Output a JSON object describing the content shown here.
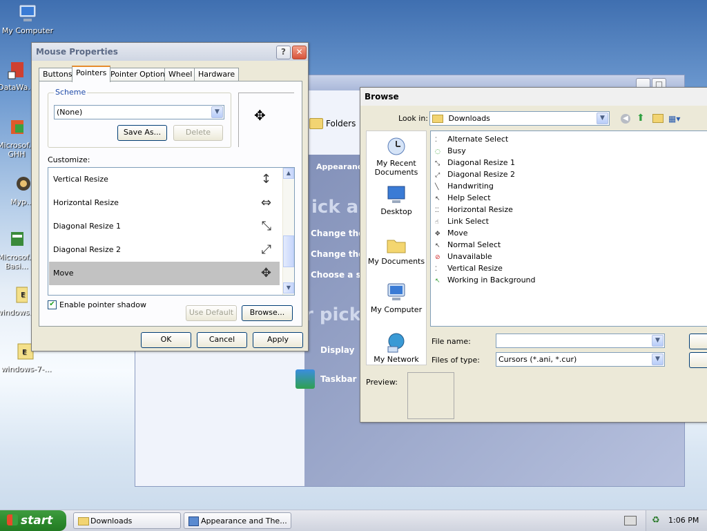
{
  "desktop": {
    "icons": [
      {
        "label": "My Computer"
      },
      {
        "label": "DataWa..."
      },
      {
        "label": "Microsof... GHH"
      },
      {
        "label": "Myp..."
      },
      {
        "label": "Microsof... Basi..."
      },
      {
        "label": "windows..."
      },
      {
        "label": "windows-7-..."
      }
    ]
  },
  "bg_window": {
    "folders_label": "Folders",
    "appearance_label": "Appearance",
    "big_text_1": "ick a t",
    "big_text_2": "r pick",
    "lines": [
      "Change the c",
      "Change the c",
      "Choose a scr"
    ],
    "display_label": "Display",
    "taskbar_label": "Taskbar a"
  },
  "mouse_props": {
    "title": "Mouse Properties",
    "tabs": [
      "Buttons",
      "Pointers",
      "Pointer Options",
      "Wheel",
      "Hardware"
    ],
    "selected_tab": "Pointers",
    "scheme_label": "Scheme",
    "scheme_value": "(None)",
    "save_as": "Save As...",
    "delete": "Delete",
    "customize_label": "Customize:",
    "cursors": [
      {
        "name": "Vertical Resize",
        "glyph": "↕"
      },
      {
        "name": "Horizontal Resize",
        "glyph": "⇔"
      },
      {
        "name": "Diagonal Resize 1",
        "glyph": "⤡"
      },
      {
        "name": "Diagonal Resize 2",
        "glyph": "⤢"
      },
      {
        "name": "Move",
        "glyph": "✥"
      }
    ],
    "selected_cursor": "Move",
    "enable_shadow": "Enable pointer shadow",
    "use_default": "Use Default",
    "browse": "Browse...",
    "ok": "OK",
    "cancel": "Cancel",
    "apply": "Apply"
  },
  "browse": {
    "title": "Browse",
    "look_in_label": "Look in:",
    "look_in_value": "Downloads",
    "places": [
      "My Recent Documents",
      "Desktop",
      "My Documents",
      "My Computer",
      "My Network"
    ],
    "files": [
      "Alternate Select",
      "Busy",
      "Diagonal Resize 1",
      "Diagonal Resize 2",
      "Handwriting",
      "Help Select",
      "Horizontal Resize",
      "Link Select",
      "Move",
      "Normal Select",
      "Unavailable",
      "Vertical Resize",
      "Working in Background"
    ],
    "file_name_label": "File name:",
    "file_name_value": "",
    "files_of_type_label": "Files of type:",
    "files_of_type_value": "Cursors (*.ani, *.cur)",
    "preview_label": "Preview:"
  },
  "taskbar": {
    "start": "start",
    "tasks": [
      "Downloads",
      "Appearance and The..."
    ],
    "clock": "1:06 PM"
  }
}
